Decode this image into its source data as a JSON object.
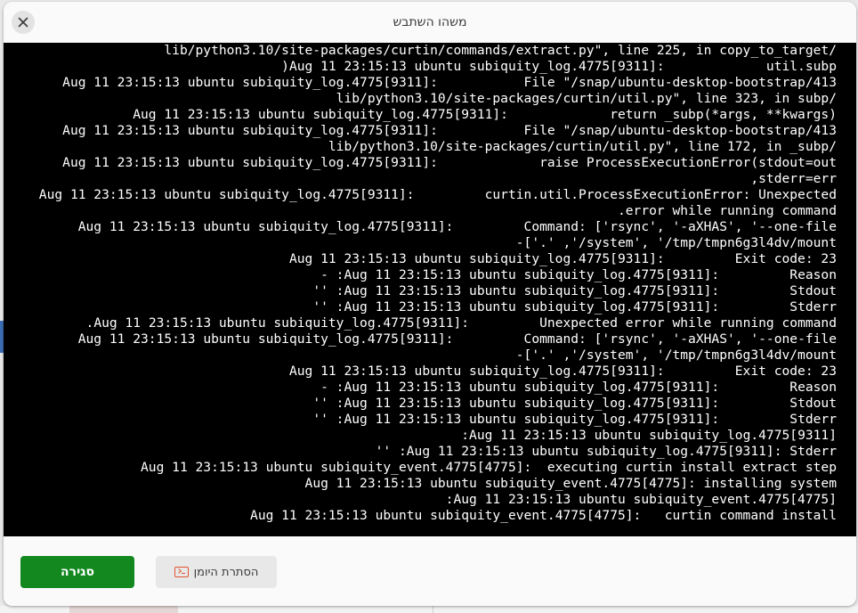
{
  "dialog": {
    "title": "משהו השתבש",
    "close_icon": "close-icon"
  },
  "log": {
    "lines": [
      "/lib/python3.10/site-packages/curtin/commands/extract.py\", line 225, in copy_to_target",
      "Aug 11 23:15:13 ubuntu subiquity_log.4775[9311]:             util.subp(",
      "Aug 11 23:15:13 ubuntu subiquity_log.4775[9311]:           File \"/snap/ubuntu-desktop-bootstrap/413",
      "/lib/python3.10/site-packages/curtin/util.py\", line 323, in subp",
      "Aug 11 23:15:13 ubuntu subiquity_log.4775[9311]:             return _subp(*args, **kwargs)",
      "Aug 11 23:15:13 ubuntu subiquity_log.4775[9311]:           File \"/snap/ubuntu-desktop-bootstrap/413",
      "/lib/python3.10/site-packages/curtin/util.py\", line 172, in _subp",
      "Aug 11 23:15:13 ubuntu subiquity_log.4775[9311]:             raise ProcessExecutionError(stdout=out",
      "stderr=err,",
      "Aug 11 23:15:13 ubuntu subiquity_log.4775[9311]:         curtin.util.ProcessExecutionError: Unexpected",
      "error while running command.",
      "Aug 11 23:15:13 ubuntu subiquity_log.4775[9311]:         Command: ['rsync', '-aXHAS', '--one-file",
      "system', '/tmp/tmpn6g3l4dv/mount/', '.']-",
      "Aug 11 23:15:13 ubuntu subiquity_log.4775[9311]:         Exit code: 23",
      "Aug 11 23:15:13 ubuntu subiquity_log.4775[9311]:         Reason: -",
      "Aug 11 23:15:13 ubuntu subiquity_log.4775[9311]:         Stdout: ''",
      "Aug 11 23:15:13 ubuntu subiquity_log.4775[9311]:         Stderr: ''",
      "Aug 11 23:15:13 ubuntu subiquity_log.4775[9311]:         Unexpected error while running command.",
      "Aug 11 23:15:13 ubuntu subiquity_log.4775[9311]:         Command: ['rsync', '-aXHAS', '--one-file",
      "system', '/tmp/tmpn6g3l4dv/mount/', '.']-",
      "Aug 11 23:15:13 ubuntu subiquity_log.4775[9311]:         Exit code: 23",
      "Aug 11 23:15:13 ubuntu subiquity_log.4775[9311]:         Reason: -",
      "Aug 11 23:15:13 ubuntu subiquity_log.4775[9311]:         Stdout: ''",
      "Aug 11 23:15:13 ubuntu subiquity_log.4775[9311]:         Stderr: ''",
      "Aug 11 23:15:13 ubuntu subiquity_log.4775[9311]:",
      "Aug 11 23:15:13 ubuntu subiquity_log.4775[9311]: Stderr: ''",
      "Aug 11 23:15:13 ubuntu subiquity_event.4775[4775]:  executing curtin install extract step",
      "Aug 11 23:15:13 ubuntu subiquity_event.4775[4775]: installing system",
      "Aug 11 23:15:13 ubuntu subiquity_event.4775[4775]:",
      "Aug 11 23:15:13 ubuntu subiquity_event.4775[4775]:   curtin command install"
    ]
  },
  "footer": {
    "close_label": "סגירה",
    "hide_log_label": "הסתרת היומן",
    "hide_log_icon": "terminal-icon"
  },
  "colors": {
    "primary_button": "#12881f",
    "terminal_background": "#000000",
    "terminal_text": "#ffffff"
  }
}
